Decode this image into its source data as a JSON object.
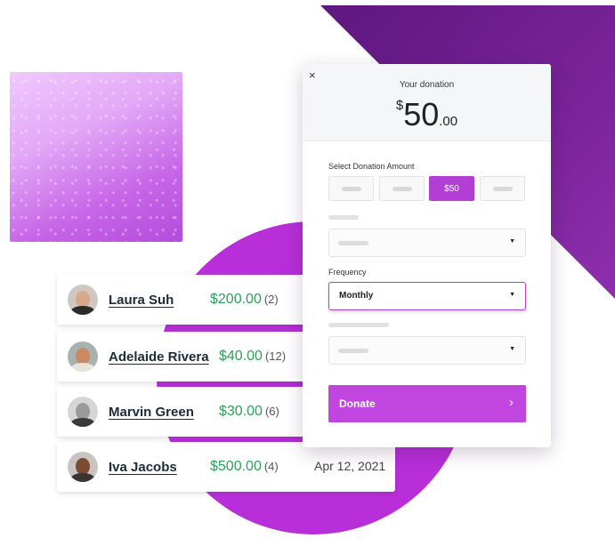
{
  "donors": [
    {
      "name": "Laura Suh",
      "amount": "$200.00",
      "count": "(2)",
      "date": ""
    },
    {
      "name": "Adelaide Rivera",
      "amount": "$40.00",
      "count": "(12)",
      "date": ""
    },
    {
      "name": "Marvin Green",
      "amount": "$30.00",
      "count": "(6)",
      "date": ""
    },
    {
      "name": "Iva Jacobs",
      "amount": "$500.00",
      "count": "(4)",
      "date": "Apr 12, 2021"
    }
  ],
  "panel": {
    "close": "×",
    "header_label": "Your donation",
    "amount_currency": "$",
    "amount_whole": "50",
    "amount_cents": ".00",
    "select_amount_label": "Select Donation Amount",
    "amount_options": [
      "",
      "",
      "$50",
      ""
    ],
    "selected_amount": "$50",
    "frequency_label": "Frequency",
    "frequency_value": "Monthly",
    "dropdown_caret": "▼",
    "donate_label": "Donate",
    "donate_chevron": "›"
  },
  "colors": {
    "brand_purple": "#b23ed6",
    "amount_green": "#2aa058",
    "triangle_purple": "#6e1d8f",
    "circle_purple": "#b82fd9"
  }
}
